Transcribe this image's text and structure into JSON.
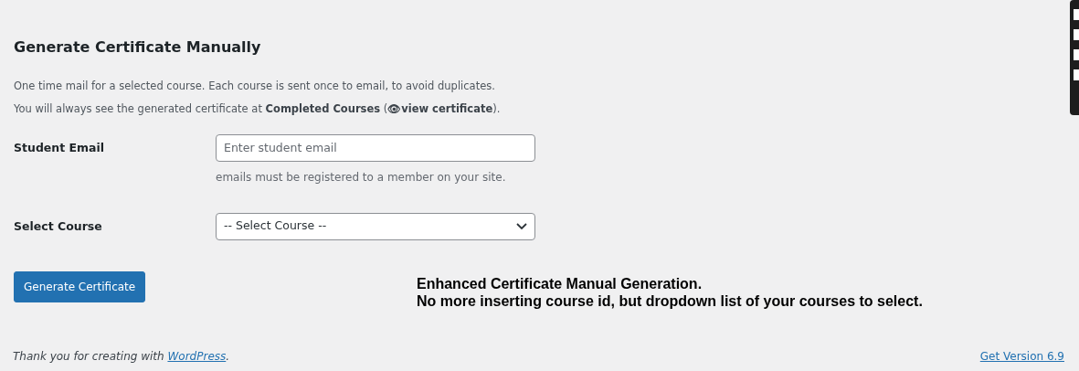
{
  "heading": "Generate Certificate Manually",
  "paragraphs": [
    "One time mail for a selected course. Each course is sent once to email, to avoid duplicates.",
    "You will always see the generated certificate at **Completed Courses** (**👁view certificate**)."
  ],
  "email": {
    "label": "Student Email",
    "placeholder": "Enter student email",
    "help": "emails must be registered to a member on your site."
  },
  "course": {
    "label": "Select Course",
    "value": "-- Select Course --"
  },
  "submit": "Generate Certificate",
  "note": [
    "Enhanced Certificate Manual Generation.",
    "No more inserting course id, but dropdown list of your courses to select."
  ],
  "footer": {
    "text": "Thank you for creating with ",
    "link": "WordPress",
    "end": ".",
    "version": "Get Version 6.9"
  }
}
